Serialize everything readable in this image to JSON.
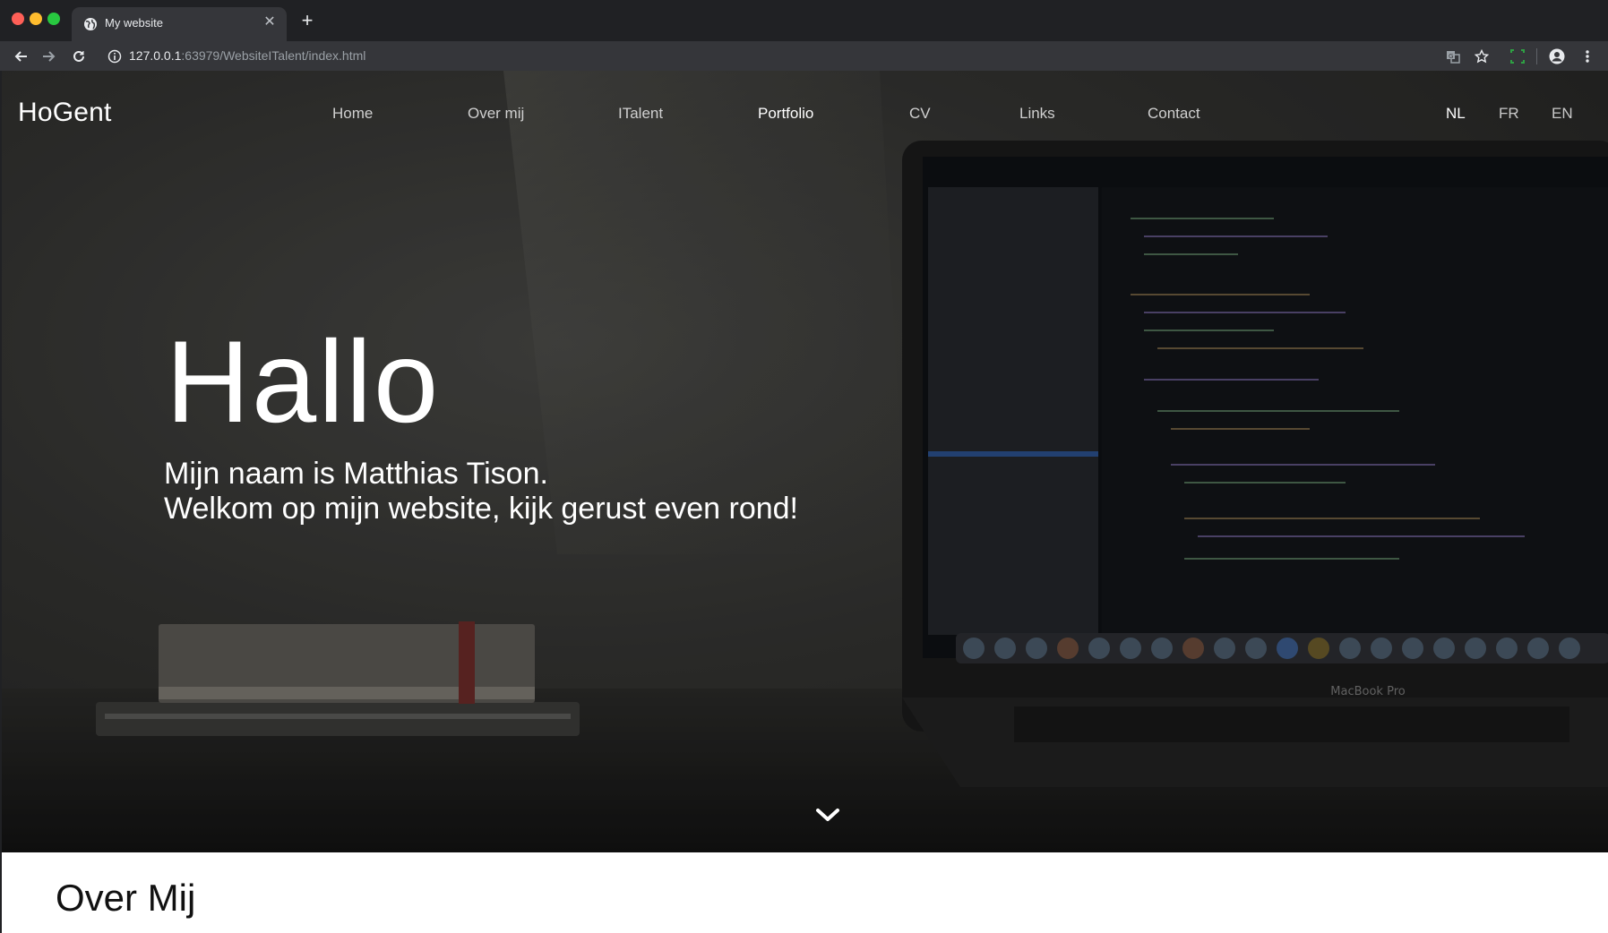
{
  "browser": {
    "tab_title": "My website",
    "url_host": "127.0.0.1",
    "url_rest": ":63979/WebsiteITalent/index.html"
  },
  "site": {
    "brand": "HoGent",
    "nav": [
      "Home",
      "Over mij",
      "ITalent",
      "Portfolio",
      "CV",
      "Links",
      "Contact"
    ],
    "active_nav": "Portfolio",
    "languages": [
      "NL",
      "FR",
      "EN"
    ],
    "active_language": "NL"
  },
  "hero": {
    "title": "Hallo",
    "line1": "Mijn naam is Matthias Tison.",
    "line2": "Welkom op mijn website, kijk gerust even rond!",
    "laptop_label": "MacBook Pro"
  },
  "about": {
    "title": "Over Mij"
  },
  "icons": {
    "back": "back-arrow-icon",
    "forward": "forward-arrow-icon",
    "reload": "reload-icon",
    "info": "info-icon",
    "translate": "translate-icon",
    "bookmark": "star-icon",
    "extension": "extension-icon",
    "profile": "profile-icon",
    "menu": "kebab-menu-icon",
    "scroll": "chevron-down-icon"
  }
}
